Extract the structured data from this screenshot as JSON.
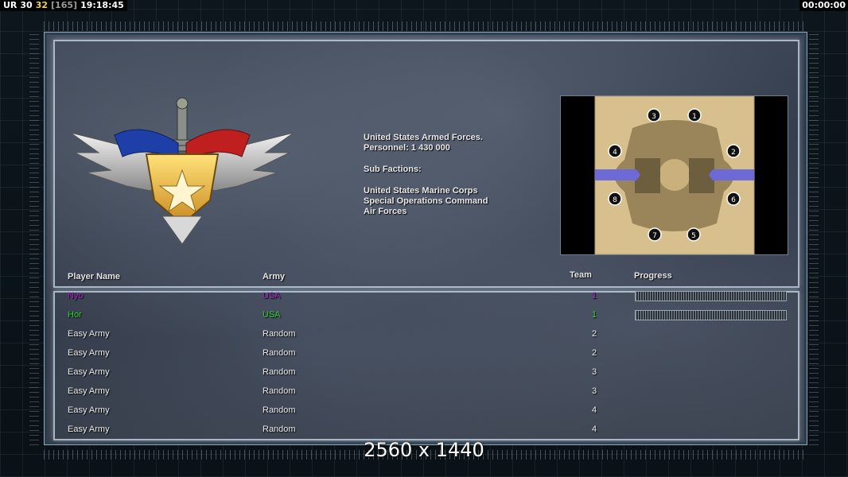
{
  "hud": {
    "label": "UR",
    "fps_a": "30",
    "fps_b": "32",
    "fps_c": "[165]",
    "clock": "19:18:45",
    "timer": "00:00:00"
  },
  "faction": {
    "line1": "United States Armed Forces.",
    "line2": "Personnel: 1 430 000",
    "subfactions_heading": "Sub Factions:",
    "sub1": "United States Marine Corps",
    "sub2": "Special Operations Command",
    "sub3": "Air Forces"
  },
  "map": {
    "slots": [
      "1",
      "2",
      "3",
      "4",
      "5",
      "6",
      "7",
      "8"
    ]
  },
  "headers": {
    "player_name": "Player Name",
    "army": "Army",
    "team": "Team",
    "progress": "Progress"
  },
  "players": [
    {
      "name": "Nyo",
      "army": "USA",
      "team": "1",
      "color": "#a020c0",
      "progress": true
    },
    {
      "name": "Hor",
      "army": "USA",
      "team": "1",
      "color": "#29d429",
      "progress": true
    },
    {
      "name": "Easy Army",
      "army": "Random",
      "team": "2",
      "color": "#ececec",
      "progress": false
    },
    {
      "name": "Easy Army",
      "army": "Random",
      "team": "2",
      "color": "#ececec",
      "progress": false
    },
    {
      "name": "Easy Army",
      "army": "Random",
      "team": "3",
      "color": "#ececec",
      "progress": false
    },
    {
      "name": "Easy Army",
      "army": "Random",
      "team": "3",
      "color": "#ececec",
      "progress": false
    },
    {
      "name": "Easy Army",
      "army": "Random",
      "team": "4",
      "color": "#ececec",
      "progress": false
    },
    {
      "name": "Easy Army",
      "army": "Random",
      "team": "4",
      "color": "#ececec",
      "progress": false
    }
  ],
  "resolution": "2560 x 1440"
}
